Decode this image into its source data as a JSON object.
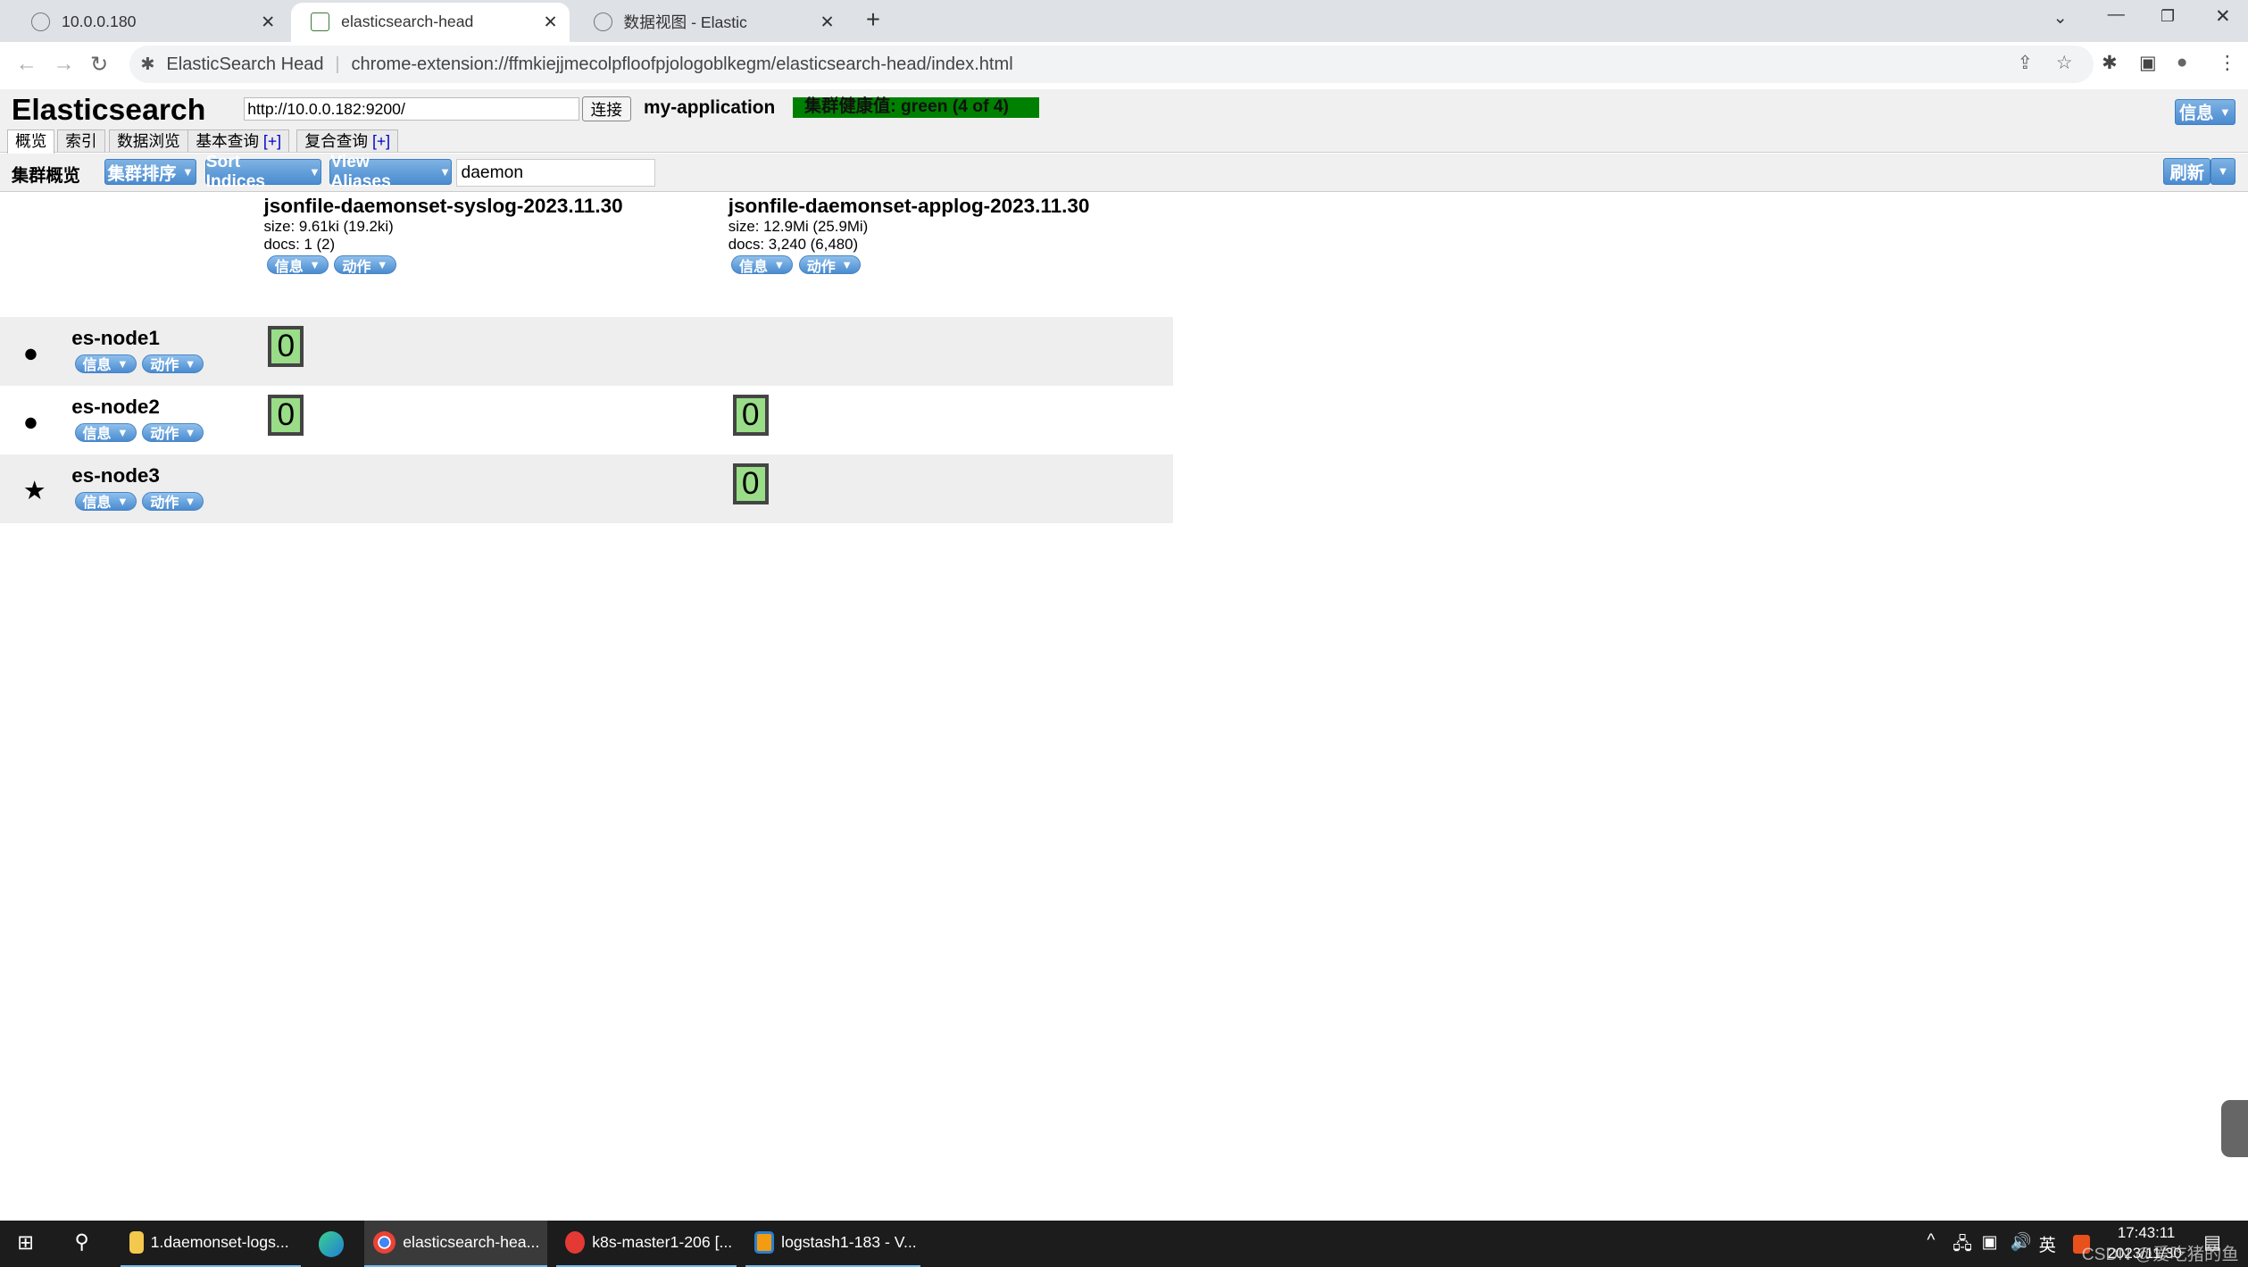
{
  "browser": {
    "tabs": [
      {
        "title": "10.0.0.180",
        "active": false
      },
      {
        "title": "elasticsearch-head",
        "active": true
      },
      {
        "title": "数据视图 - Elastic",
        "active": false
      }
    ],
    "new_tab": "+",
    "site_name": "ElasticSearch Head",
    "url": "chrome-extension://ffmkiejjmecolpfloofpjologoblkegm/elasticsearch-head/index.html"
  },
  "app": {
    "title": "Elasticsearch",
    "server_url": "http://10.0.0.182:9200/",
    "connect_label": "连接",
    "cluster_name": "my-application",
    "health": "集群健康值: green (4 of 4)",
    "health_color": "#008000",
    "info_label": "信息",
    "tabs": [
      {
        "label": "概览",
        "active": true
      },
      {
        "label": "索引"
      },
      {
        "label": "数据浏览"
      },
      {
        "label": "基本查询",
        "plus": "[+]"
      },
      {
        "label": "复合查询",
        "plus": "[+]"
      }
    ]
  },
  "toolbar": {
    "title": "集群概览",
    "cluster_sort": "集群排序",
    "sort_indices": "Sort Indices",
    "view_aliases": "View Aliases",
    "filter_value": "daemon",
    "refresh": "刷新"
  },
  "indices": [
    {
      "name": "jsonfile-daemonset-syslog-2023.11.30",
      "size": "size: 9.61ki (19.2ki)",
      "docs": "docs: 1 (2)",
      "info": "信息",
      "action": "动作"
    },
    {
      "name": "jsonfile-daemonset-applog-2023.11.30",
      "size": "size: 12.9Mi (25.9Mi)",
      "docs": "docs: 3,240 (6,480)",
      "info": "信息",
      "action": "动作"
    }
  ],
  "nodes": [
    {
      "name": "es-node1",
      "icon": "circle-icon",
      "info": "信息",
      "action": "动作",
      "shards": [
        "0",
        null
      ]
    },
    {
      "name": "es-node2",
      "icon": "circle-icon",
      "info": "信息",
      "action": "动作",
      "shards": [
        "0",
        "0"
      ]
    },
    {
      "name": "es-node3",
      "icon": "star-icon",
      "info": "信息",
      "action": "动作",
      "shards": [
        null,
        "0"
      ]
    }
  ],
  "shard_color": "#99dd88",
  "taskbar": {
    "items": [
      {
        "label": "1.daemonset-logs..."
      },
      {
        "label": "elasticsearch-hea...",
        "active": true
      },
      {
        "label": "k8s-master1-206 [..."
      },
      {
        "label": "logstash1-183 - V..."
      }
    ],
    "ime": "英",
    "time": "17:43:11",
    "date": "2023/11/30",
    "watermark": "CSDN @爱吃猪的鱼"
  }
}
